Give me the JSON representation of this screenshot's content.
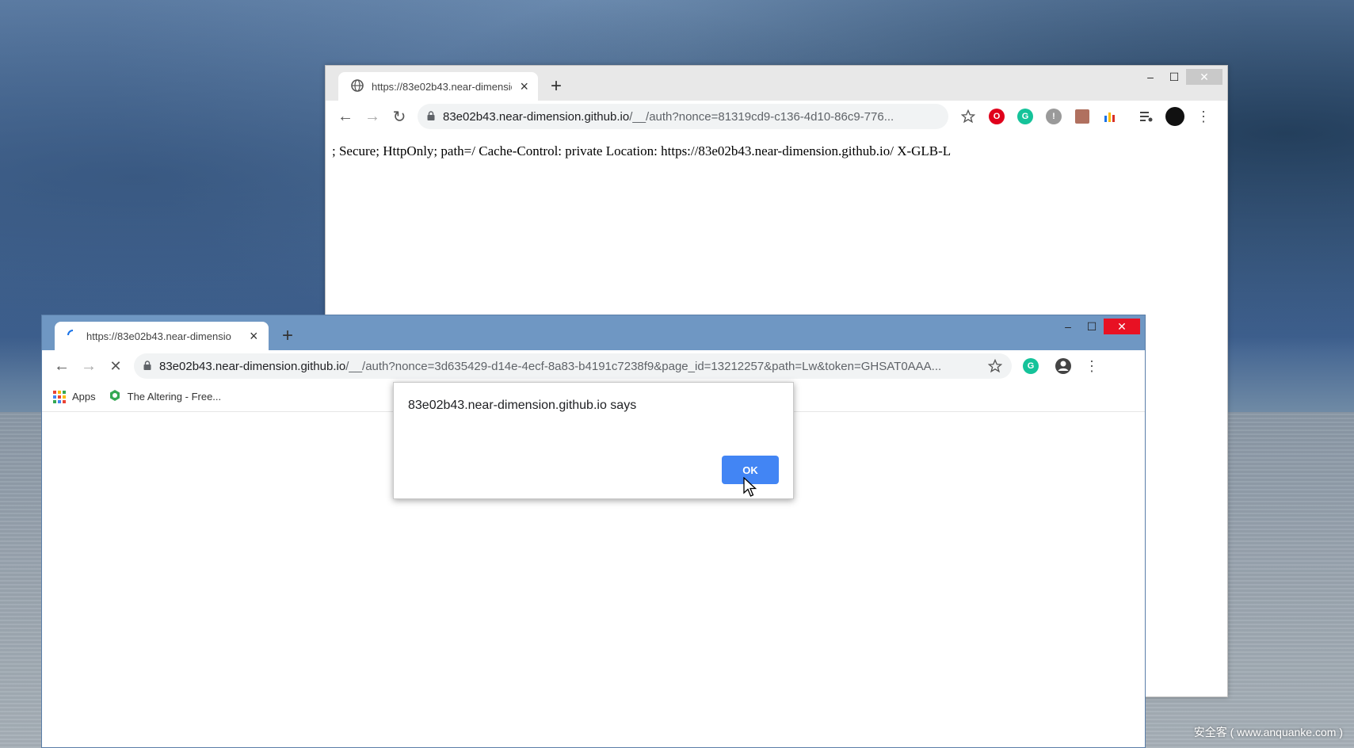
{
  "back_window": {
    "tab_title": "https://83e02b43.near-dimensio",
    "new_tab_symbol": "+",
    "url_host": "83e02b43.near-dimension.github.io",
    "url_rest": "/__/auth?nonce=81319cd9-c136-4d10-86c9-776...",
    "page_text": "; Secure; HttpOnly; path=/ Cache-Control: private Location: https://83e02b43.near-dimension.github.io/ X-GLB-L",
    "controls": {
      "minimize": "–",
      "maximize": "☐",
      "close": "✕"
    },
    "extensions": [
      "opera-icon",
      "grammarly-icon",
      "shield-extension-icon",
      "pdf-icon",
      "analytics-icon",
      "media-icon",
      "profile-avatar"
    ]
  },
  "front_window": {
    "tab_title": "https://83e02b43.near-dimensio",
    "new_tab_symbol": "+",
    "url_host": "83e02b43.near-dimension.github.io",
    "url_rest": "/__/auth?nonce=3d635429-d14e-4ecf-8a83-b4191c7238f9&page_id=13212257&path=Lw&token=GHSAT0AAA...",
    "controls": {
      "minimize": "–",
      "maximize": "☐",
      "close": "✕"
    },
    "bookmarks": [
      {
        "label": "Apps",
        "icon": "apps-grid-icon"
      },
      {
        "label": "The Altering - Free...",
        "icon": "altering-icon"
      }
    ]
  },
  "dialog": {
    "message": "83e02b43.near-dimension.github.io says",
    "ok_label": "OK"
  },
  "watermark": "安全客 ( www.anquanke.com )",
  "colors": {
    "front_frame": "#6f97c3",
    "back_frame": "#e8e8e8",
    "close_red": "#e81123",
    "ok_blue": "#4285f4",
    "grammarly_green": "#15c39a"
  }
}
